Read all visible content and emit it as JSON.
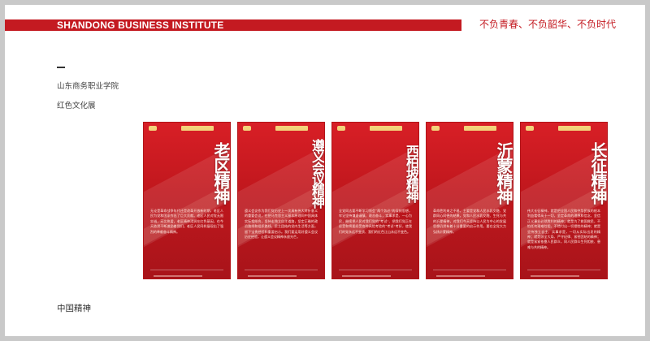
{
  "header": {
    "institute": "SHANDONG BUSINESS INSTITUTE",
    "slogan": "不负青春、不负韶华、不负时代"
  },
  "left": {
    "school": "山东商务职业学院",
    "exhibition": "红色文化展",
    "footer": "中国精神"
  },
  "posters": [
    {
      "title": "老区精神",
      "body": "无论是革命战争年代还是改革开放新时期，老区人民为党和国家作出了巨大贡献。老区人民对党无限忠诚，无比热爱，老区精神浸润在红色基因，在今天依然不断激励着我们。老区人民同样展现出了强烈的奉献奋斗精神。"
    },
    {
      "title": "遵义会议精神",
      "body": "遵义会议作为我们党历史上一次具有伟大转折意义的重要会议，在把马克思主义基本原理同中国具体实际相结合，坚持走独立自主道路，坚定正确的政治路线和组织路线，民主团结的党内生活等方面，留下宝贵经验和重要启示。我们要运用好遵义会议历史经验，让遵义会议精神永放光芒。"
    },
    {
      "title": "西柏坡精神",
      "body": "全党同志要不断学习领会“两个务必”的深刻思想，牢记坚持谦虚谨慎、艰苦奋斗，实事求是、一心为民，继续把人民对我们党的“考试”、把我们党正在经受和将要经受各种风险考验的“考试”考好，使我们的党永远不变质、我们的红色江山永远不变色。"
    },
    {
      "title": "沂蒙精神",
      "body": "革命胜利来之不易，主要是党和人民水乳交融、党群同心同德的结果。党和人民水乳交融、生死与共的沂蒙精神，对我们今天坚持以人民为中心的发展思想仍然有着十分重要的启示作用。要在全党大力弘扬沂蒙精神。"
    },
    {
      "title": "长征精神",
      "body": "伟大长征精神，就是把全国人民和中华民族的根本利益看得高于一切，坚定革命的理想和信念，坚信正义事业必然胜利的精神；就是为了救国救民，不怕任何艰难险阻，不惜付出一切牺牲的精神；就是坚持独立自主、实事求是，一切从实际出发的精神；就是顾全大局、严守纪律、紧密团结的精神；就是紧紧依靠人民群众，同人民群众生死相依、患难与共的精神。"
    }
  ],
  "colors": {
    "brand_red": "#c41a21",
    "frame_gray": "#c9c9c9"
  }
}
